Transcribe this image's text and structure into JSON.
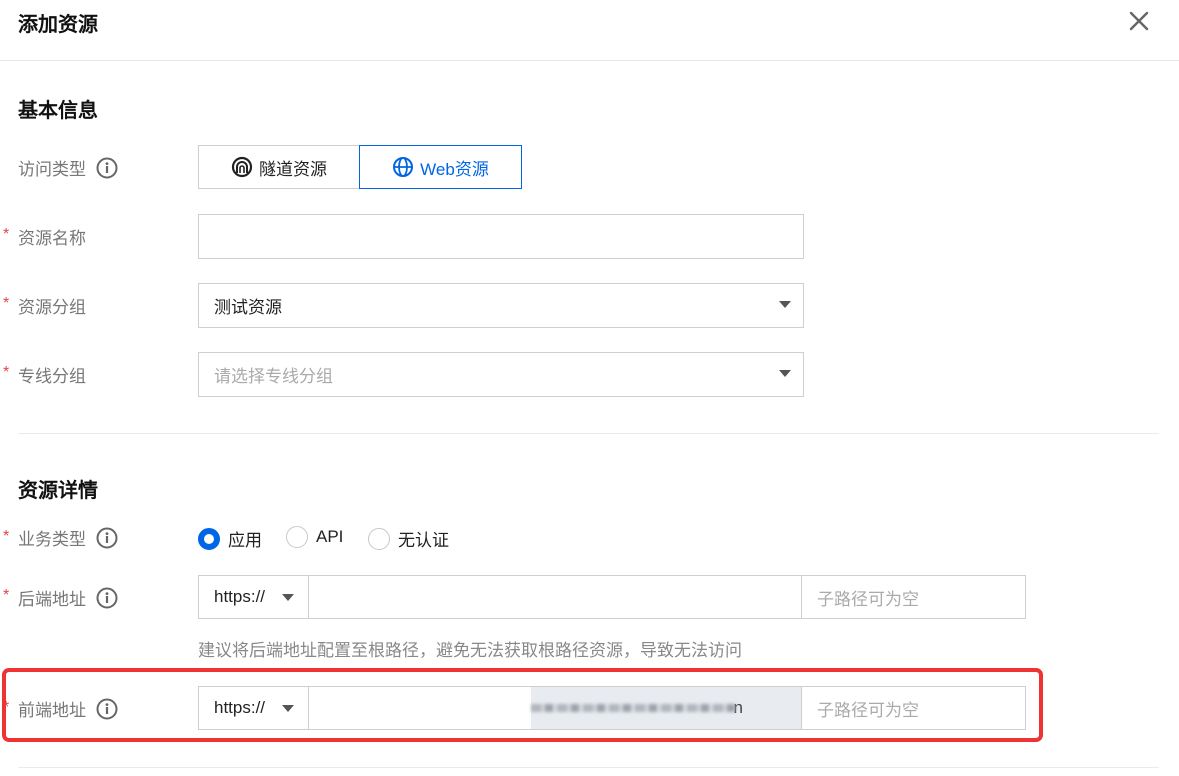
{
  "dialog": {
    "title": "添加资源"
  },
  "basic": {
    "section_title": "基本信息",
    "access_type": {
      "label": "访问类型",
      "options": [
        {
          "label": "隧道资源",
          "icon": "tunnel-icon"
        },
        {
          "label": "Web资源",
          "icon": "globe-icon"
        }
      ],
      "selected": "Web资源"
    },
    "resource_name": {
      "label": "资源名称",
      "value": ""
    },
    "resource_group": {
      "label": "资源分组",
      "value": "测试资源"
    },
    "line_group": {
      "label": "专线分组",
      "placeholder": "请选择专线分组"
    }
  },
  "details": {
    "section_title": "资源详情",
    "business_type": {
      "label": "业务类型",
      "options": [
        "应用",
        "API",
        "无认证"
      ],
      "selected": "应用"
    },
    "backend": {
      "label": "后端地址",
      "protocol": "https://",
      "path_placeholder": "子路径可为空",
      "hint": "建议将后端地址配置至根路径，避免无法获取根路径资源，导致无法访问"
    },
    "frontend": {
      "label": "前端地址",
      "protocol": "https://",
      "host_suffix": "n",
      "path_placeholder": "子路径可为空"
    }
  },
  "colors": {
    "accent": "#0066e6",
    "required": "#e54545",
    "highlight": "#ee3333"
  }
}
